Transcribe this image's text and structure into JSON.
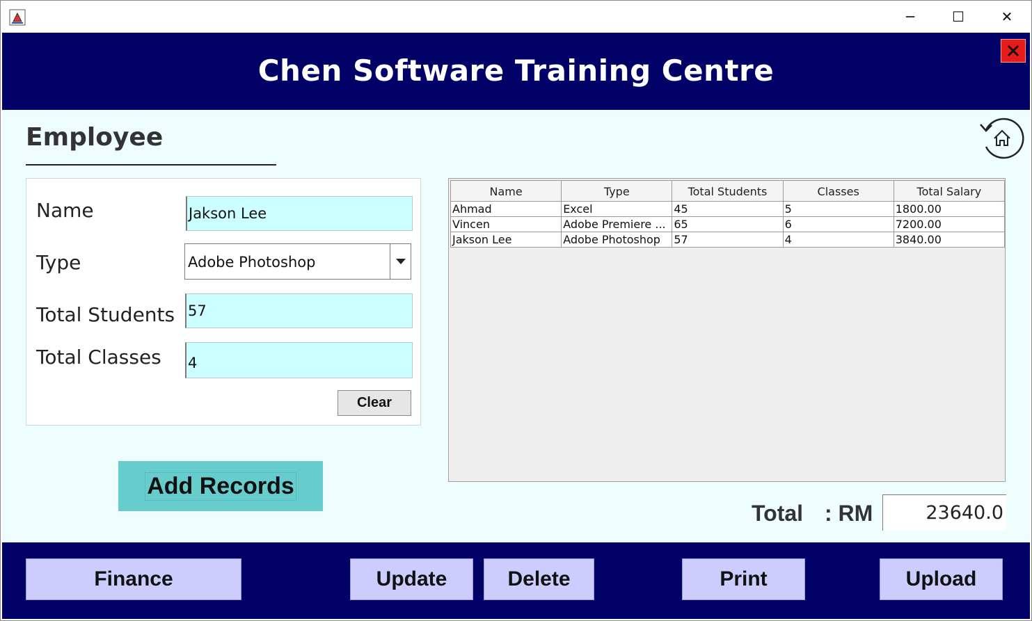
{
  "window": {
    "controls": {
      "minimize": "─",
      "maximize": "☐",
      "close": "✕"
    }
  },
  "header": {
    "title": "Chen Software Training Centre",
    "close_glyph": "✕"
  },
  "section": {
    "title": "Employee"
  },
  "form": {
    "name_label": "Name",
    "name_value": "Jakson Lee",
    "type_label": "Type",
    "type_value": "Adobe Photoshop",
    "students_label": "Total Students",
    "students_value": "57",
    "classes_label": "Total Classes",
    "classes_value": "4",
    "clear_label": "Clear"
  },
  "add_button": {
    "label": "Add Records"
  },
  "table": {
    "columns": [
      "Name",
      "Type",
      "Total Students",
      "Classes",
      "Total Salary"
    ],
    "rows": [
      [
        "Ahmad",
        "Excel",
        "45",
        "5",
        "1800.00"
      ],
      [
        "Vincen",
        "Adobe Premiere ...",
        "65",
        "6",
        "7200.00"
      ],
      [
        "Jakson Lee",
        "Adobe Photoshop",
        "57",
        "4",
        "3840.00"
      ]
    ]
  },
  "total": {
    "label": "Total",
    "currency": ": RM",
    "value": "23640.0"
  },
  "footer": {
    "finance": "Finance",
    "update": "Update",
    "delete": "Delete",
    "print": "Print",
    "upload": "Upload"
  },
  "colors": {
    "header_bg": "#000066",
    "content_bg": "#eefdfd",
    "field_bg": "#ccffff",
    "button_bg": "#ccccff",
    "add_bg": "#66cccc",
    "close_red": "#e81b1b"
  }
}
